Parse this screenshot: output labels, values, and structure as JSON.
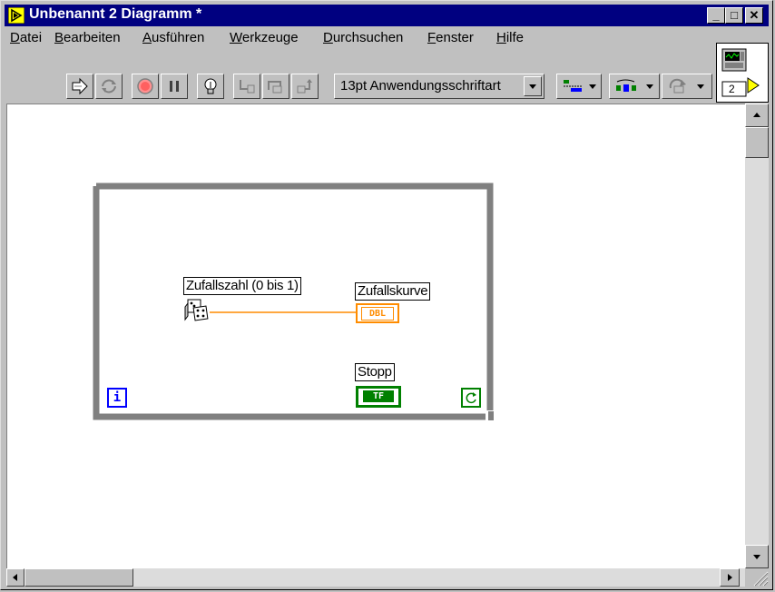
{
  "window": {
    "title": "Unbenannt 2 Diagramm *",
    "minimize_label": "_",
    "maximize_label": "□",
    "close_label": "✕"
  },
  "menu": [
    "Datei",
    "Bearbeiten",
    "Ausführen",
    "Werkzeuge",
    "Durchsuchen",
    "Fenster",
    "Hilfe"
  ],
  "toolbar": {
    "font_select": "13pt Anwendungsschriftart",
    "buttons": [
      "run-arrow-icon",
      "run-continuous-icon",
      "abort-icon",
      "pause-icon",
      "highlight-execution-icon",
      "step-into-icon",
      "step-over-icon",
      "step-out-icon",
      "align-objects-icon",
      "distribute-objects-icon",
      "reorder-icon"
    ]
  },
  "connector_pane": {
    "terminal_count": "2"
  },
  "diagram": {
    "random_label": "Zufallszahl (0 bis 1)",
    "chart_label": "Zufallskurve",
    "chart_terminal": "DBL",
    "stop_label": "Stopp",
    "stop_terminal": "TF",
    "iteration_terminal": "i"
  },
  "colors": {
    "titlebar": "#000080",
    "while_loop": "#808080",
    "wire_orange": "#ff8c00",
    "boolean_green": "#008000",
    "iteration_blue": "#0000ff"
  }
}
